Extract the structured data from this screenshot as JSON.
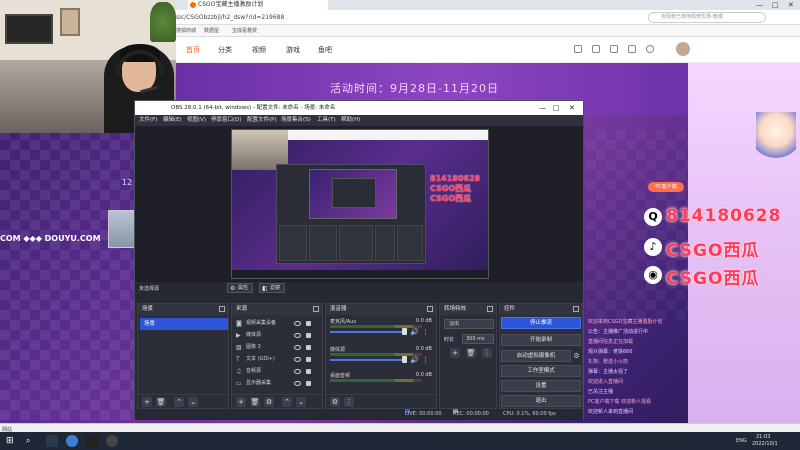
{
  "browser": {
    "tab_title": "CSGO宝藏主播激励计划",
    "url": "sic/CSGObzzbjl/h2_dsw?rid=219688",
    "search_placeholder": "有佩奇已使用佩奇优惠·微博",
    "bookmarks": [
      "搜狐商城",
      "数据屋",
      "宝成看着费"
    ],
    "status_text": "网站"
  },
  "site": {
    "nav": [
      "首页",
      "分类",
      "视频",
      "游戏",
      "鱼吧"
    ],
    "event_text": "活动时间：9月28日-11月20日",
    "douyu_text": "COM ◆◆◆ DOUYU.COM",
    "room_count": "12",
    "promo_badge": "PC客户端"
  },
  "social": {
    "qq": "814180628",
    "douyin": "CSGO西瓜",
    "weibo": "CSGO西瓜"
  },
  "chat": [
    "欢迎来到CSGO宝藏主播激励计划",
    "公告：主播推广活动进行中",
    "直播间信息正在加载",
    "观众弹幕：老铁666",
    "礼物：赠送小火箭",
    "弹幕：主播太强了",
    "欢迎进入直播间",
    "已关注主播",
    "PC客户端下载  欢迎新人观看",
    "欢迎新人来到直播间"
  ],
  "obs": {
    "title": "OBS 28.0.1 (64-bit, windows) - 配置文件: 未命名 - 场景: 未命名",
    "menu": [
      "文件(F)",
      "编辑(E)",
      "视图(V)",
      "停靠窗口(D)",
      "配置文件(P)",
      "场景集合(S)",
      "工具(T)",
      "帮助(H)"
    ],
    "no_source": "未选择源",
    "properties_btn": "属性",
    "filters_btn": "滤镜",
    "docks": {
      "scenes": "场景",
      "sources": "来源",
      "mixer": "混音器",
      "transitions": "转场特效",
      "controls": "控件"
    },
    "scene_item": "场景",
    "sources": [
      "视频采集设备",
      "媒体源",
      "图像 2",
      "文本 (GDI+)",
      "音频源",
      "显示器采集"
    ],
    "mixer": [
      {
        "name": "麦克风/Aux",
        "db": "0.0 dB"
      },
      {
        "name": "媒体源",
        "db": "0.0 dB"
      },
      {
        "name": "桌面音频",
        "db": "0.0 dB"
      }
    ],
    "transition": {
      "type": "淡出",
      "duration_label": "时长",
      "duration": "300 ms"
    },
    "controls": [
      "停止推流",
      "开始录制",
      "启动虚拟摄像机",
      "工作室模式",
      "设置",
      "退出"
    ],
    "status": {
      "live": "LIVE: 00:00:00",
      "rec": "REC: 00:00:00",
      "cpu": "CPU: 0.1%, 60.00 fps"
    }
  },
  "taskbar": {
    "lang": "ENG",
    "time": "21:03",
    "date": "2022/10/1"
  }
}
